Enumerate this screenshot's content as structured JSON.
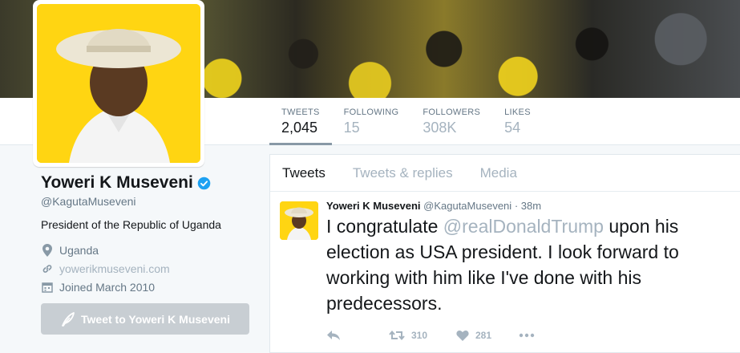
{
  "profile": {
    "name": "Yoweri K Museveni",
    "handle": "@KagutaMuseveni",
    "bio": "President of the Republic of Uganda",
    "location": "Uganda",
    "website": "yowerikmuseveni.com",
    "joined": "Joined March 2010",
    "tweet_to_label": "Tweet to Yoweri K Museveni"
  },
  "stats": [
    {
      "label": "TWEETS",
      "value": "2,045"
    },
    {
      "label": "FOLLOWING",
      "value": "15"
    },
    {
      "label": "FOLLOWERS",
      "value": "308K"
    },
    {
      "label": "LIKES",
      "value": "54"
    }
  ],
  "tabs": [
    "Tweets",
    "Tweets & replies",
    "Media"
  ],
  "tweet": {
    "name": "Yoweri K Museveni",
    "handle": "@KagutaMuseveni",
    "sep": "·",
    "time": "38m",
    "text_before": "I congratulate ",
    "mention": "@realDonaldTrump",
    "text_after": " upon his election as USA president. I look forward to working with him like I've done with his predecessors.",
    "retweets": "310",
    "likes": "281"
  },
  "colors": {
    "accent": "#1da1f2",
    "verified": "#1da1f2",
    "avatar_bg": "#ffd512",
    "muted": "#657786"
  },
  "icons": [
    "verified-badge-icon",
    "location-pin-icon",
    "link-icon",
    "calendar-icon",
    "quill-icon",
    "reply-icon",
    "retweet-icon",
    "heart-icon",
    "more-icon"
  ]
}
